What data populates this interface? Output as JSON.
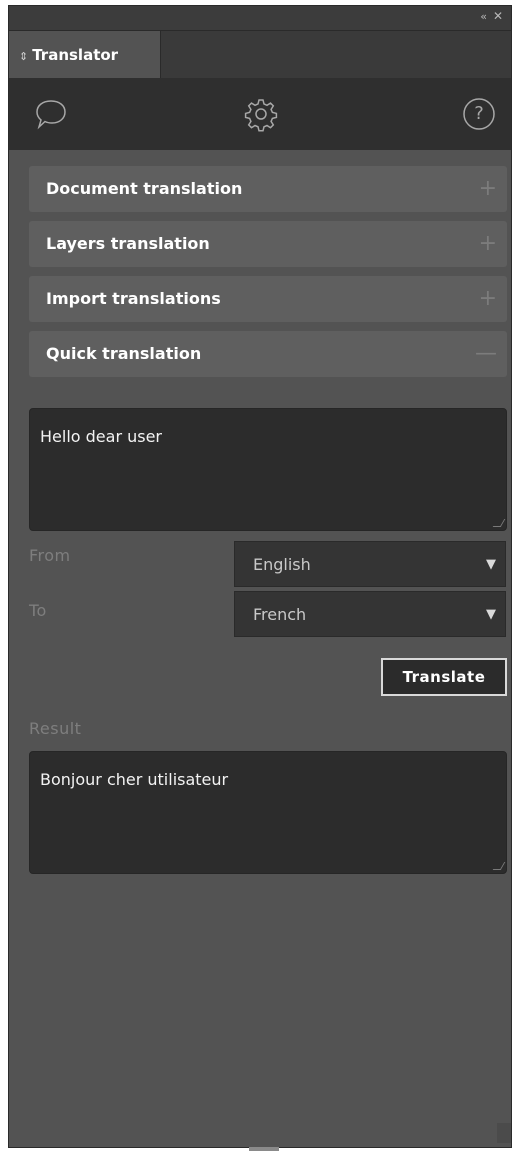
{
  "window": {
    "collapse_glyph": "‹‹",
    "close_glyph": "✕"
  },
  "tab": {
    "arrow_glyph": "⇕",
    "title": "Translator"
  },
  "toolbar": {
    "icons": [
      "chat-bubble-icon",
      "gear-icon",
      "help-icon"
    ],
    "help_glyph": "?"
  },
  "sections": [
    {
      "label": "Document translation",
      "sign": "+"
    },
    {
      "label": "Layers translation",
      "sign": "+"
    },
    {
      "label": "Import translations",
      "sign": "+"
    },
    {
      "label": "Quick translation",
      "sign": "—"
    }
  ],
  "quick": {
    "source_text": "Hello dear user",
    "from_label": "From",
    "from_value": "English",
    "to_label": "To",
    "to_value": "French",
    "caret_glyph": "▼",
    "translate_label": "Translate",
    "result_label": "Result",
    "result_text": "Bonjour cher utilisateur"
  },
  "colors": {
    "panel_bg": "#535353",
    "header_bg": "#2f2f2f",
    "section_bg": "#5f5f5f",
    "field_bg": "#2c2c2c",
    "label_text": "#7e7e7e"
  }
}
